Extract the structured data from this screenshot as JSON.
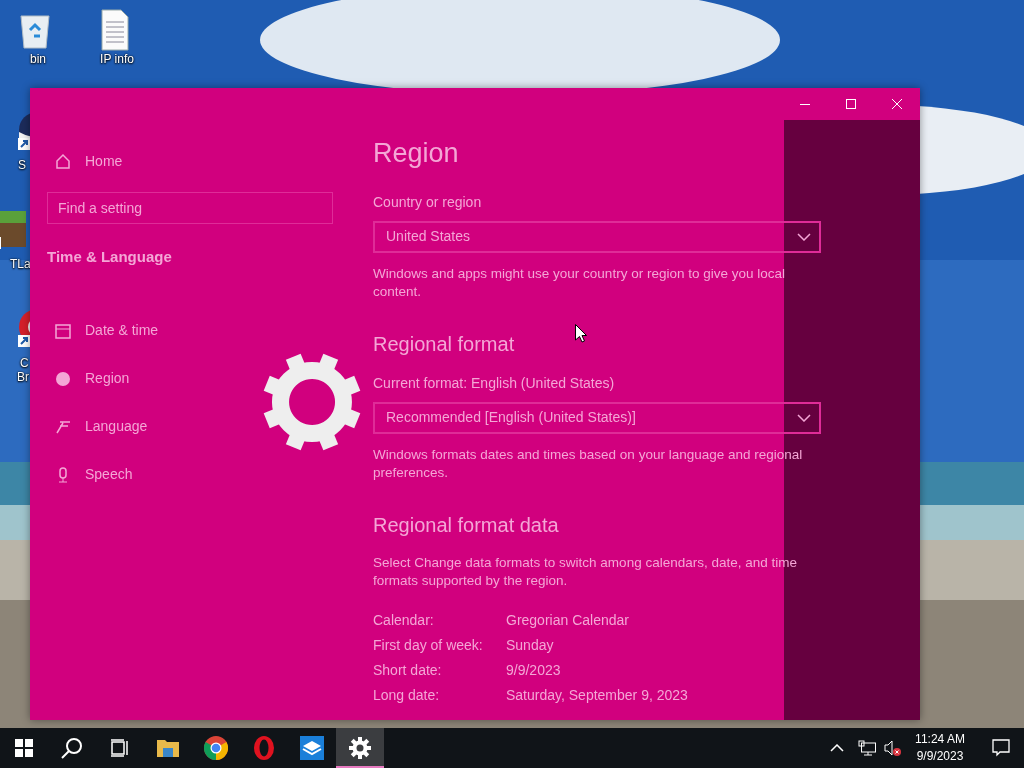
{
  "desktop_icons": [
    {
      "kind": "recycle-bin",
      "lines": [
        "bin"
      ]
    },
    {
      "kind": "document",
      "lines": [
        "IP info"
      ]
    },
    {
      "kind": "round-app",
      "lines": [
        "S"
      ]
    },
    {
      "kind": "block-app",
      "lines": [
        "TLa"
      ]
    },
    {
      "kind": "red-app",
      "lines": [
        "C",
        "Br"
      ]
    }
  ],
  "window": {
    "loading": true,
    "controls": [
      {
        "kind": "minimize"
      },
      {
        "kind": "maximize"
      },
      {
        "kind": "close"
      }
    ]
  },
  "sidebar": {
    "home": "Home",
    "search": {
      "placeholder": "Find a setting"
    },
    "section": "Time & Language",
    "items": [
      {
        "kind": "calendar",
        "label": "Date & time"
      },
      {
        "kind": "globe",
        "label": "Region"
      },
      {
        "kind": "language",
        "label": "Language"
      },
      {
        "kind": "microphone",
        "label": "Speech"
      }
    ]
  },
  "content": {
    "title": "Region",
    "blocks": [
      {
        "kind": "label",
        "text": "Country or region"
      },
      {
        "kind": "dropdown",
        "text": "United States"
      },
      {
        "kind": "text",
        "text": "Windows and apps might use your country or region to give you local content."
      },
      {
        "kind": "heading",
        "text": "Regional format"
      },
      {
        "kind": "label",
        "text": "Current format: English (United States)"
      },
      {
        "kind": "dropdown",
        "text": "Recommended [English (United States)]"
      },
      {
        "kind": "text",
        "text": "Windows formats dates and times based on your language and regional preferences."
      },
      {
        "kind": "heading",
        "text": "Regional format data"
      },
      {
        "kind": "text",
        "text": "Select Change data formats to switch among calendars, date, and time formats supported by the region."
      }
    ],
    "rows": [
      {
        "name": "Calendar:",
        "value": "Gregorian Calendar"
      },
      {
        "name": "First day of week:",
        "value": "Sunday"
      },
      {
        "name": "Short date:",
        "value": "9/9/2023"
      },
      {
        "name": "Long date:",
        "value": "Saturday, September 9, 2023"
      }
    ]
  },
  "taskbar": {
    "apps": [
      {
        "kind": "start",
        "selected": false
      },
      {
        "kind": "search",
        "selected": false
      },
      {
        "kind": "task-view",
        "selected": false
      },
      {
        "kind": "folder",
        "selected": false
      },
      {
        "kind": "chrome",
        "selected": false
      },
      {
        "kind": "opera",
        "selected": false
      },
      {
        "kind": "blue-box",
        "selected": false
      },
      {
        "kind": "gear",
        "selected": true
      }
    ],
    "tray": {
      "volume_muted": true,
      "time": "11:24 AM",
      "date": "9/9/2023"
    }
  }
}
